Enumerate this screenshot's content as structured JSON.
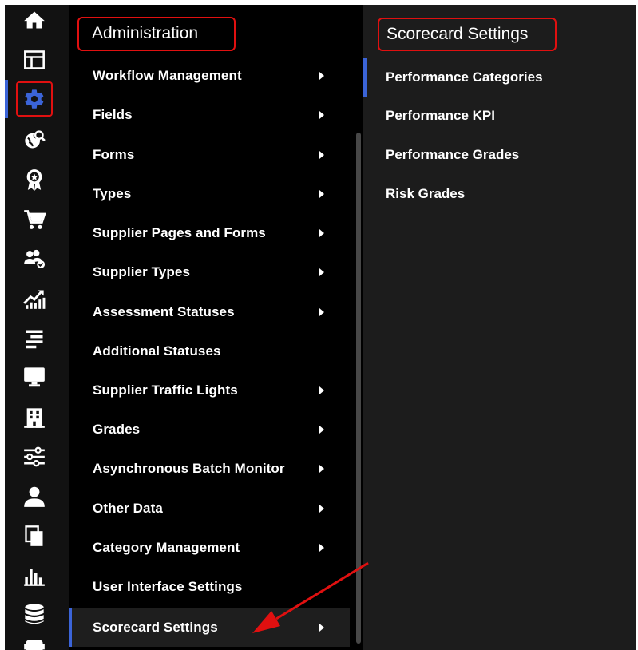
{
  "rail": {
    "items": [
      {
        "icon": "home-icon"
      },
      {
        "icon": "dashboard-layout-icon"
      },
      {
        "icon": "gear-icon",
        "active": true
      },
      {
        "icon": "globe-search-icon"
      },
      {
        "icon": "award-ribbon-icon"
      },
      {
        "icon": "shopping-cart-icon"
      },
      {
        "icon": "users-check-icon"
      },
      {
        "icon": "trend-chart-icon"
      },
      {
        "icon": "align-lines-icon"
      },
      {
        "icon": "monitor-icon"
      },
      {
        "icon": "building-icon"
      },
      {
        "icon": "sliders-icon"
      },
      {
        "icon": "user-icon"
      },
      {
        "icon": "copy-documents-icon"
      },
      {
        "icon": "bar-chart-icon"
      },
      {
        "icon": "database-icon"
      },
      {
        "icon": "robot-icon"
      }
    ],
    "accent_color": "#3b64d8"
  },
  "admin_menu": {
    "title": "Administration",
    "items": [
      {
        "label": "Workflow Management",
        "has_submenu": true
      },
      {
        "label": "Fields",
        "has_submenu": true
      },
      {
        "label": "Forms",
        "has_submenu": true
      },
      {
        "label": "Types",
        "has_submenu": true
      },
      {
        "label": "Supplier Pages and Forms",
        "has_submenu": true
      },
      {
        "label": "Supplier Types",
        "has_submenu": true
      },
      {
        "label": "Assessment Statuses",
        "has_submenu": true
      },
      {
        "label": "Additional Statuses",
        "has_submenu": false
      },
      {
        "label": "Supplier Traffic Lights",
        "has_submenu": true
      },
      {
        "label": "Grades",
        "has_submenu": true
      },
      {
        "label": "Asynchronous Batch Monitor",
        "has_submenu": true
      },
      {
        "label": "Other Data",
        "has_submenu": true
      },
      {
        "label": "Category Management",
        "has_submenu": true
      },
      {
        "label": "User Interface Settings",
        "has_submenu": false
      },
      {
        "label": "Scorecard Settings",
        "has_submenu": true,
        "active": true
      }
    ]
  },
  "scorecard_menu": {
    "title": "Scorecard Settings",
    "items": [
      {
        "label": "Performance Categories",
        "active": true
      },
      {
        "label": "Performance KPI"
      },
      {
        "label": "Performance Grades"
      },
      {
        "label": "Risk Grades"
      }
    ]
  },
  "highlight_color": "#e01010"
}
